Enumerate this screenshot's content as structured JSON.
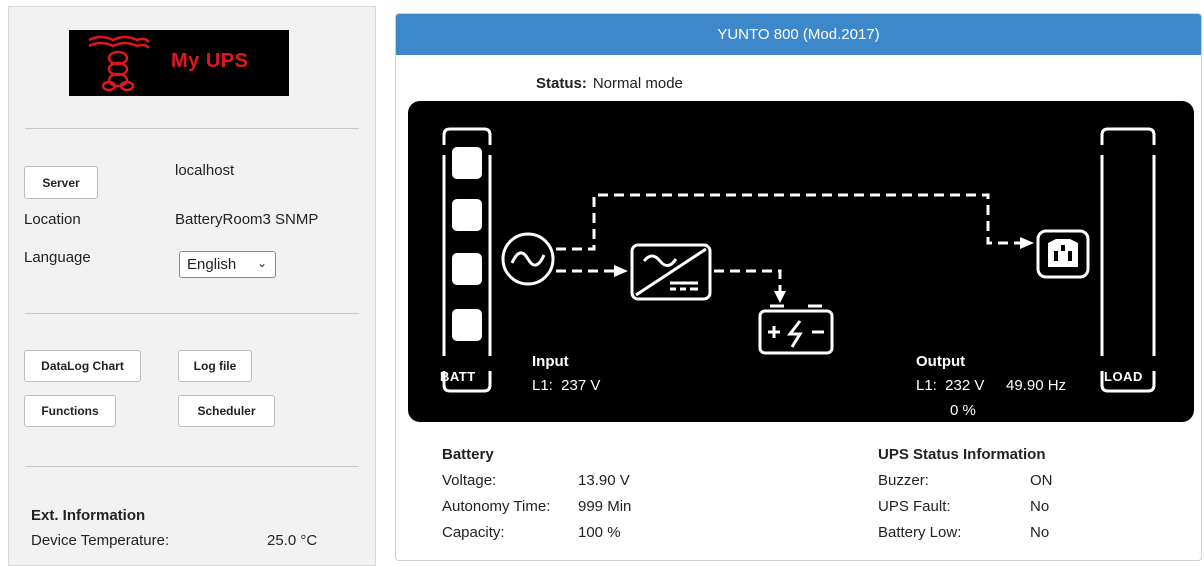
{
  "sidebar": {
    "logo_text": "My UPS",
    "server_button": "Server",
    "server_value": "localhost",
    "location_label": "Location",
    "location_value": "BatteryRoom3 SNMP",
    "language_label": "Language",
    "language_selected": "English",
    "buttons": {
      "datalog": "DataLog Chart",
      "logfile": "Log file",
      "functions": "Functions",
      "scheduler": "Scheduler"
    },
    "ext_title": "Ext. Information",
    "device_temp_label": "Device Temperature:",
    "device_temp_value": "25.0 °C"
  },
  "panel": {
    "title": "YUNTO 800 (Mod.2017)",
    "status_label": "Status:",
    "status_value": "Normal mode",
    "diagram": {
      "batt_label": "BATT",
      "load_label": "LOAD",
      "input_title": "Input",
      "input_l1": "L1:  237 V",
      "output_title": "Output",
      "output_l1": "L1:  232 V",
      "output_hz": "49.90 Hz",
      "output_load": "0 %"
    },
    "battery": {
      "title": "Battery",
      "voltage_label": "Voltage:",
      "voltage_value": "13.90 V",
      "autonomy_label": "Autonomy Time:",
      "autonomy_value": "999 Min",
      "capacity_label": "Capacity:",
      "capacity_value": "100 %"
    },
    "ups_status": {
      "title": "UPS Status Information",
      "buzzer_label": "Buzzer:",
      "buzzer_value": "ON",
      "fault_label": "UPS Fault:",
      "fault_value": "No",
      "battlow_label": "Battery Low:",
      "battlow_value": "No"
    }
  },
  "colors": {
    "header_blue": "#3d88cb",
    "logo_red": "#e0171d"
  }
}
